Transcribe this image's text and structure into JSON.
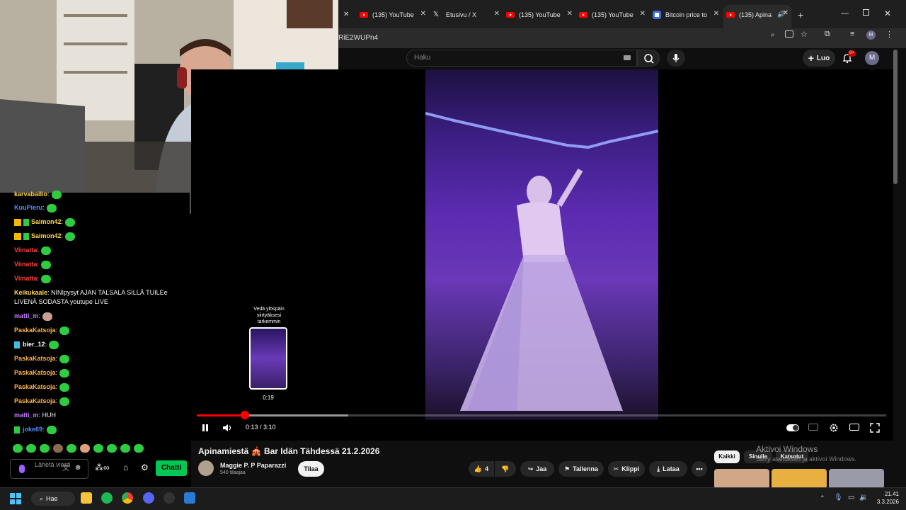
{
  "browser": {
    "tabs": [
      {
        "label": "(135) YouTube",
        "icon": "youtube-icon",
        "active": false
      },
      {
        "label": "Etusivu / X",
        "icon": "x-icon",
        "active": false
      },
      {
        "label": "(135) YouTube",
        "icon": "youtube-icon",
        "active": false
      },
      {
        "label": "(135) YouTube",
        "icon": "youtube-icon",
        "active": false
      },
      {
        "label": "Bitcoin price to",
        "icon": "site-icon",
        "active": false
      },
      {
        "label": "(135) Apina",
        "icon": "youtube-icon",
        "active": true
      }
    ],
    "url_fragment": "RiE2WUPn4"
  },
  "youtube": {
    "search_placeholder": "Haku",
    "create_label": "Luo",
    "notification_badge": "9+",
    "avatar_letter": "M",
    "video_title": "Apinamiestä 🎪 Bar Idän Tähdessä 21.2.2026",
    "channel_name": "Maggie P. P Paparazzi",
    "subscribers": "540 tilaajaa",
    "subscribe_label": "Tilaa",
    "likes": "4",
    "share_label": "Jaa",
    "save_label": "Tallenna",
    "clip_label": "Klippi",
    "download_label": "Lataa",
    "chips": [
      "Kaikki",
      "Sinulle",
      "Katsotut"
    ],
    "windows_watermark_1": "Aktivoi Windows",
    "windows_watermark_2": "Siirry asetuksiin ja aktivoi Windows."
  },
  "player": {
    "time_display": "0:13 / 3:10",
    "played_fraction": 0.07,
    "buffered_fraction": 0.22,
    "preview_hint": "Vedä ylöspäin siirtyäksesi tarkemmin",
    "preview_time": "0:19"
  },
  "chat": {
    "messages": [
      {
        "user": "karvabailio",
        "color": "#ffd54f",
        "text": ":"
      },
      {
        "user": "KuuPieru",
        "color": "#4f8cff",
        "text": ":"
      },
      {
        "user": "Saimon42",
        "color": "#ffd54f",
        "text": ":"
      },
      {
        "user": "Saimon42",
        "color": "#ffd54f",
        "text": ":"
      },
      {
        "user": "Viinatta",
        "color": "#ff4040",
        "text": ":"
      },
      {
        "user": "Viinatta",
        "color": "#ff4040",
        "text": ":"
      },
      {
        "user": "Viinatta",
        "color": "#ff4040",
        "text": ":"
      },
      {
        "user": "Keikukaale",
        "color": "#ffd54f",
        "text": ": NINIpysyt AJAN TALSALA SILLÄ TUILEe"
      },
      {
        "user": "",
        "color": "#ffffff",
        "text": "LIVENÄ SODASTA youtupe LIVE"
      },
      {
        "user": "matti_m",
        "color": "#c27bff",
        "text": ":"
      },
      {
        "user": "PaskaKatsoja",
        "color": "#ffb347",
        "text": ":"
      },
      {
        "user": "bier_12",
        "color": "#ffffff",
        "text": ":"
      },
      {
        "user": "PaskaKatsoja",
        "color": "#ffb347",
        "text": ":"
      },
      {
        "user": "PaskaKatsoja",
        "color": "#ffb347",
        "text": ":"
      },
      {
        "user": "PaskaKatsoja",
        "color": "#ffb347",
        "text": ":"
      },
      {
        "user": "PaskaKatsoja",
        "color": "#ffb347",
        "text": ":"
      },
      {
        "user": "matti_m",
        "color": "#c27bff",
        "text": ": HUH"
      },
      {
        "user": "joke69",
        "color": "#4f8cff",
        "text": ":"
      }
    ],
    "input_placeholder": "Lähetä viesti",
    "chat_button": "Chatti"
  },
  "taskbar": {
    "search_label": "Hae",
    "time": "21.41",
    "date": "3.3.2026"
  }
}
